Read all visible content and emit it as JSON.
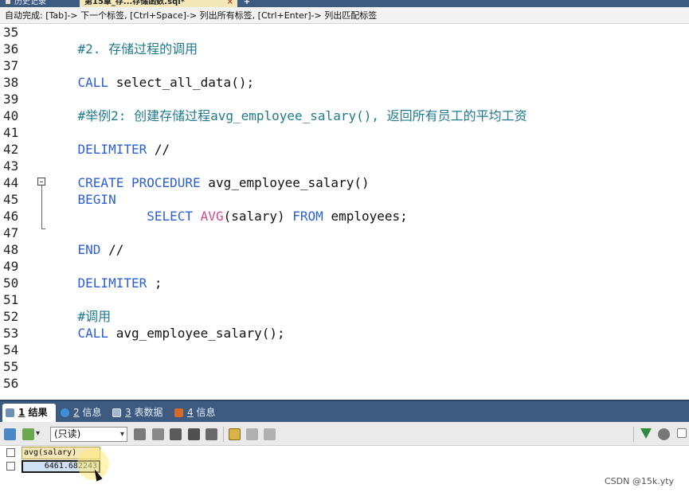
{
  "tabs": {
    "history_label": "历史记录",
    "file_label": "第15章_存...存储函数.sql*",
    "close_glyph": "×",
    "add_glyph": "+"
  },
  "hint": "自动完成: [Tab]-> 下一个标签, [Ctrl+Space]-> 列出所有标签, [Ctrl+Enter]-> 列出匹配标签",
  "editor": {
    "line_numbers": [
      "35",
      "36",
      "37",
      "38",
      "39",
      "40",
      "41",
      "42",
      "43",
      "44",
      "45",
      "46",
      "47",
      "48",
      "49",
      "50",
      "51",
      "52",
      "53",
      "54",
      "55",
      "56"
    ],
    "code": {
      "l35": "#2. 存储过程的调用",
      "l37_kw": "CALL",
      "l37_rest": " select_all_data();",
      "l39": "#举例2: 创建存储过程avg_employee_salary(), 返回所有员工的平均工资",
      "l41_kw": "DELIMITER",
      "l41_rest": " //",
      "l43_kw1": "CREATE",
      "l43_kw2": "PROCEDURE",
      "l43_rest": " avg_employee_salary()",
      "l44_kw": "BEGIN",
      "l45_kw1": "SELECT",
      "l45_fn": "AVG",
      "l45_mid": "(salary) ",
      "l45_kw2": "FROM",
      "l45_rest": " employees;",
      "l47_kw": "END",
      "l47_rest": " //",
      "l49_kw": "DELIMITER",
      "l49_rest": " ;",
      "l51": "#调用",
      "l52_kw": "CALL",
      "l52_rest": " avg_employee_salary();"
    }
  },
  "result_tabs": [
    {
      "num": "1",
      "label": "结果"
    },
    {
      "num": "2",
      "label": "信息"
    },
    {
      "num": "3",
      "label": "表数据"
    },
    {
      "num": "4",
      "label": "信息"
    }
  ],
  "toolbar": {
    "mode_select": "(只读)"
  },
  "grid": {
    "column": "avg(salary)",
    "value": "6461.682243"
  },
  "watermark": "CSDN @15k.yty",
  "colors": {
    "keyword": "#2b5fd9",
    "comment": "#1e7a8c",
    "function": "#d9468a",
    "tab_bar": "#3d5a80"
  }
}
